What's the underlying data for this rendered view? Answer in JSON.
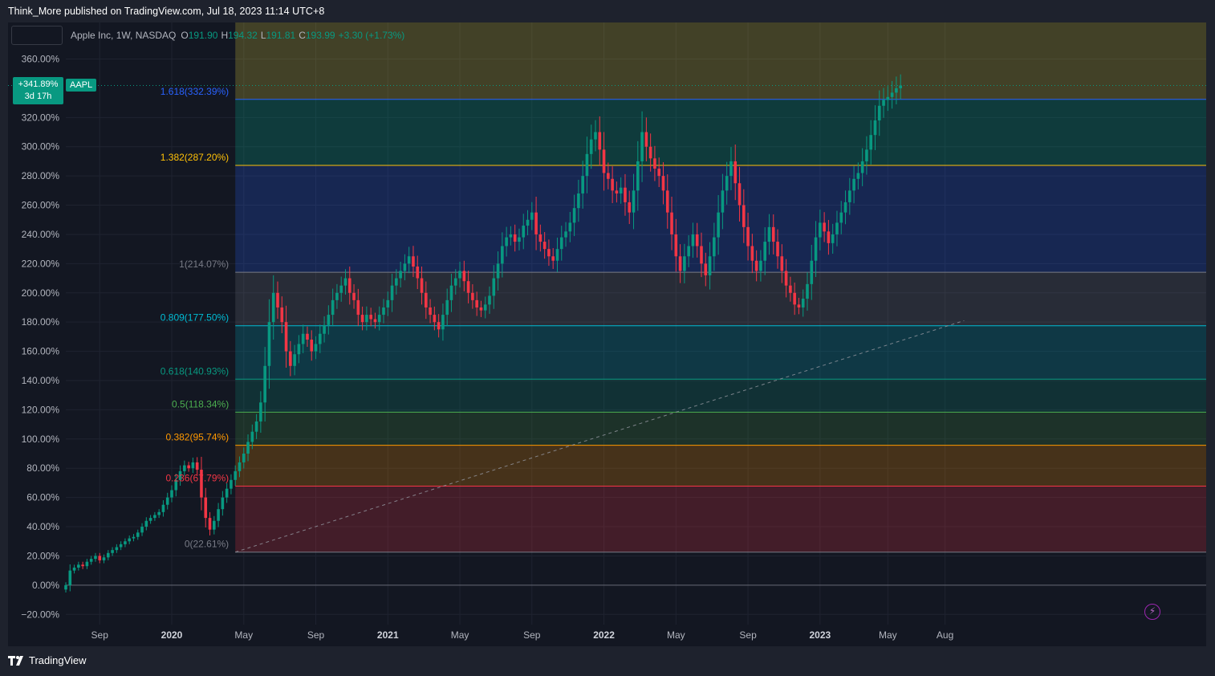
{
  "header": {
    "published_text": "Think_More published on TradingView.com, Jul 18, 2023 11:14 UTC+8"
  },
  "legend": {
    "title": "Apple Inc, 1W, NASDAQ",
    "open_label": "O",
    "open": "191.90",
    "high_label": "H",
    "high": "194.32",
    "low_label": "L",
    "low": "191.81",
    "close_label": "C",
    "close": "193.99",
    "change": "+3.30 (+1.73%)"
  },
  "price_badge": {
    "value": "+341.89%",
    "countdown": "3d 17h",
    "ticker": "AAPL"
  },
  "footer": {
    "brand": "TradingView"
  },
  "colors": {
    "up": "#089981",
    "down": "#f23645",
    "background": "#131722",
    "page": "#1e222d"
  },
  "icons": [
    "lightning-icon",
    "tradingview-logo-icon"
  ],
  "chart_data": {
    "type": "candlestick",
    "symbol": "AAPL",
    "interval": "1W",
    "y_unit": "percent change",
    "ylim": [
      -27,
      385
    ],
    "y_ticks": [
      -20,
      0,
      20,
      40,
      60,
      80,
      100,
      120,
      140,
      160,
      180,
      200,
      220,
      240,
      260,
      280,
      300,
      320,
      360
    ],
    "y_tick_labels": [
      "−20.00%",
      "0.00%",
      "20.00%",
      "40.00%",
      "60.00%",
      "80.00%",
      "100.00%",
      "120.00%",
      "140.00%",
      "160.00%",
      "180.00%",
      "200.00%",
      "220.00%",
      "240.00%",
      "260.00%",
      "280.00%",
      "300.00%",
      "320.00%",
      "360.00%"
    ],
    "x_ticks": [
      {
        "label": "Sep",
        "week": 8,
        "bold": false
      },
      {
        "label": "2020",
        "week": 25,
        "bold": true
      },
      {
        "label": "May",
        "week": 42,
        "bold": false
      },
      {
        "label": "Sep",
        "week": 59,
        "bold": false
      },
      {
        "label": "2021",
        "week": 76,
        "bold": true
      },
      {
        "label": "May",
        "week": 93,
        "bold": false
      },
      {
        "label": "Sep",
        "week": 110,
        "bold": false
      },
      {
        "label": "2022",
        "week": 127,
        "bold": true
      },
      {
        "label": "May",
        "week": 144,
        "bold": false
      },
      {
        "label": "Sep",
        "week": 161,
        "bold": false
      },
      {
        "label": "2023",
        "week": 178,
        "bold": true
      },
      {
        "label": "May",
        "week": 194,
        "bold": false
      },
      {
        "label": "Aug",
        "week": 207.5,
        "bold": false
      }
    ],
    "fib_start_week": 40,
    "fib_levels": [
      {
        "ratio": 0,
        "label": "0(22.61%)",
        "value": 22.61,
        "color": "#787b86",
        "fill": null
      },
      {
        "ratio": 0.236,
        "label": "0.236(67.79%)",
        "value": 67.79,
        "color": "#f23645",
        "fill": "rgba(242,54,69,0.22)"
      },
      {
        "ratio": 0.382,
        "label": "0.382(95.74%)",
        "value": 95.74,
        "color": "#ff9800",
        "fill": "rgba(255,152,0,0.22)"
      },
      {
        "ratio": 0.5,
        "label": "0.5(118.34%)",
        "value": 118.34,
        "color": "#4caf50",
        "fill": "rgba(76,175,80,0.18)"
      },
      {
        "ratio": 0.618,
        "label": "0.618(140.93%)",
        "value": 140.93,
        "color": "#089981",
        "fill": "rgba(8,153,129,0.20)"
      },
      {
        "ratio": 0.809,
        "label": "0.809(177.50%)",
        "value": 177.5,
        "color": "#00bcd4",
        "fill": "rgba(0,188,212,0.20)"
      },
      {
        "ratio": 1,
        "label": "1(214.07%)",
        "value": 214.07,
        "color": "#787b86",
        "fill": "rgba(120,123,134,0.22)"
      },
      {
        "ratio": 1.382,
        "label": "1.382(287.20%)",
        "value": 287.2,
        "color": "#ffc107",
        "fill": "rgba(41,98,255,0.22)"
      },
      {
        "ratio": 1.618,
        "label": "1.618(332.39%)",
        "value": 332.39,
        "color": "#2962ff",
        "fill": "rgba(8,153,129,0.28)"
      },
      {
        "ratio": 2,
        "label": "",
        "value": 400,
        "color": "#787b86",
        "fill": "rgba(255,235,59,0.20)"
      }
    ],
    "trend_line": {
      "from": {
        "week": 40,
        "value": 22.61
      },
      "to": {
        "week": 212,
        "value": 181
      }
    },
    "current_value": 341.89,
    "closes": [
      0,
      10,
      12,
      14,
      13,
      16,
      18,
      20,
      17,
      19,
      22,
      24,
      26,
      28,
      30,
      32,
      33,
      36,
      40,
      44,
      46,
      48,
      50,
      55,
      60,
      65,
      72,
      78,
      82,
      80,
      84,
      79,
      60,
      46,
      38,
      44,
      52,
      60,
      66,
      72,
      78,
      84,
      90,
      98,
      105,
      112,
      125,
      150,
      180,
      200,
      190,
      180,
      160,
      150,
      158,
      165,
      172,
      168,
      160,
      165,
      172,
      178,
      185,
      195,
      200,
      205,
      210,
      200,
      195,
      185,
      180,
      185,
      182,
      180,
      185,
      190,
      195,
      205,
      210,
      215,
      220,
      225,
      218,
      210,
      200,
      190,
      185,
      180,
      175,
      185,
      195,
      205,
      210,
      215,
      208,
      200,
      195,
      190,
      188,
      192,
      198,
      210,
      220,
      232,
      238,
      240,
      235,
      238,
      246,
      250,
      255,
      240,
      235,
      230,
      225,
      222,
      230,
      238,
      242,
      248,
      258,
      268,
      280,
      295,
      305,
      310,
      298,
      282,
      278,
      270,
      268,
      272,
      262,
      255,
      270,
      290,
      310,
      300,
      292,
      285,
      280,
      270,
      255,
      240,
      225,
      215,
      225,
      232,
      240,
      232,
      220,
      212,
      225,
      238,
      255,
      270,
      280,
      290,
      275,
      260,
      245,
      232,
      222,
      215,
      222,
      235,
      245,
      235,
      225,
      215,
      205,
      200,
      192,
      190,
      196,
      206,
      222,
      238,
      248,
      242,
      234,
      240,
      248,
      255,
      262,
      270,
      278,
      282,
      290,
      298,
      308,
      318,
      328,
      332,
      334,
      337,
      340,
      341.89
    ]
  }
}
